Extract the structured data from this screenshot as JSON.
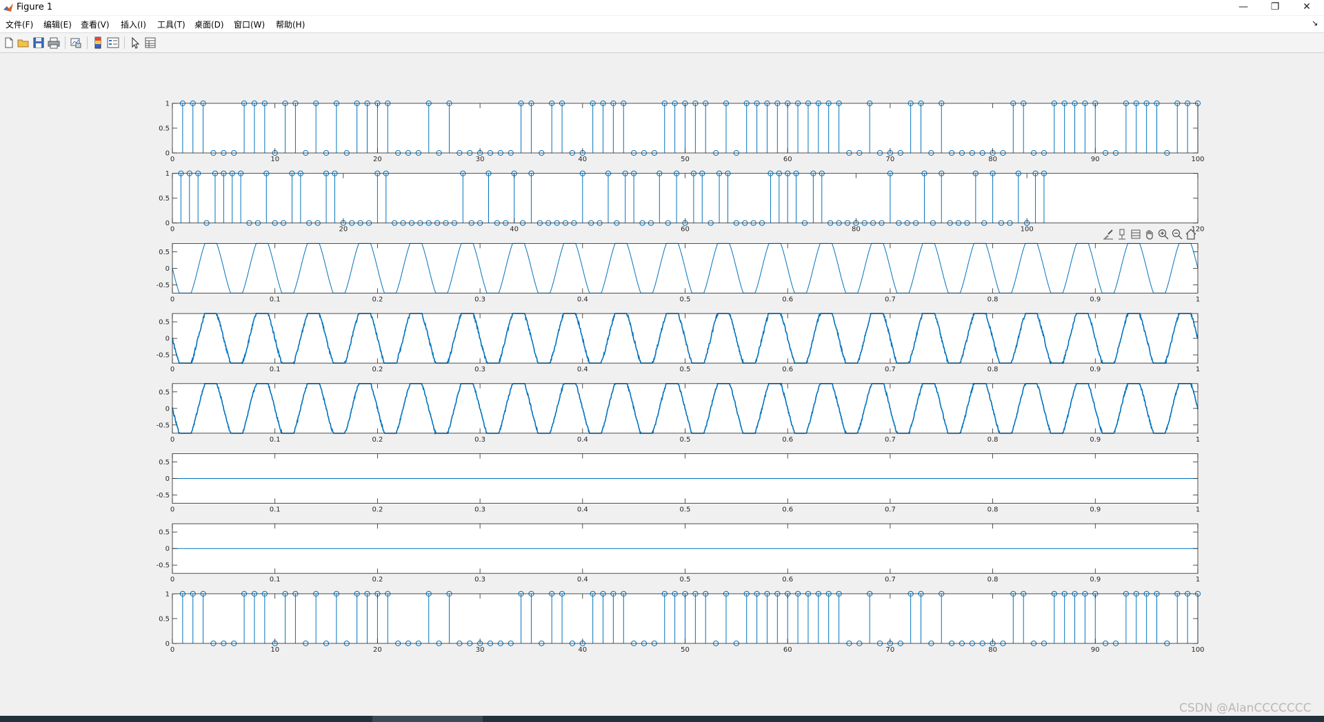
{
  "window": {
    "title": "Figure 1",
    "minimize": "—",
    "maximize": "❐",
    "close": "✕"
  },
  "menu": [
    {
      "label": "文件(F)"
    },
    {
      "label": "编辑(E)"
    },
    {
      "label": "查看(V)"
    },
    {
      "label": "插入(I)"
    },
    {
      "label": "工具(T)"
    },
    {
      "label": "桌面(D)"
    },
    {
      "label": "窗口(W)"
    },
    {
      "label": "帮助(H)"
    }
  ],
  "menu_arrow": "↘",
  "toolbar_icons": [
    "new-figure-icon",
    "open-file-icon",
    "save-icon",
    "print-icon",
    "link-plot-icon",
    "colorbar-icon",
    "legend-icon",
    "edit-plot-icon",
    "property-inspector-icon"
  ],
  "axes_toolbar_icons": [
    "brush-icon",
    "data-tips-icon",
    "pan-icon",
    "zoom-in-icon",
    "zoom-out-icon",
    "restore-view-icon"
  ],
  "colors": {
    "line": "#0072bd",
    "axes_bg": "#ffffff",
    "figure_bg": "#f0f0f0"
  },
  "watermark": "CSDN @AlanCCCCCCC",
  "chart_data": [
    {
      "type": "stem",
      "xlim": [
        0,
        100
      ],
      "ylim": [
        0,
        1
      ],
      "xticks": [
        0,
        10,
        20,
        30,
        40,
        50,
        60,
        70,
        80,
        90,
        100
      ],
      "yticks": [
        0,
        0.5,
        1
      ],
      "xticklabels": [
        "0",
        "10",
        "20",
        "30",
        "40",
        "50",
        "60",
        "70",
        "80",
        "90",
        "100"
      ],
      "yticklabels": [
        "0",
        "0.5",
        "1"
      ],
      "x_start": 1,
      "values": [
        1,
        1,
        1,
        0,
        0,
        0,
        1,
        1,
        1,
        0,
        1,
        1,
        0,
        1,
        0,
        1,
        0,
        1,
        1,
        1,
        1,
        0,
        0,
        0,
        1,
        0,
        1,
        0,
        0,
        0,
        0,
        0,
        0,
        1,
        1,
        0,
        1,
        1,
        0,
        0,
        1,
        1,
        1,
        1,
        0,
        0,
        0,
        1,
        1,
        1,
        1,
        1,
        0,
        1,
        0,
        1,
        1,
        1,
        1,
        1,
        1,
        1,
        1,
        1,
        1,
        0,
        0,
        1,
        0,
        0,
        0,
        1,
        1,
        0,
        1,
        0,
        0,
        0,
        0,
        0,
        0,
        1,
        1,
        0,
        0,
        1,
        1,
        1,
        1,
        1,
        0,
        0,
        1,
        1,
        1,
        1,
        0,
        1,
        1,
        1
      ]
    },
    {
      "type": "stem",
      "xlim": [
        0,
        120
      ],
      "ylim": [
        0,
        1
      ],
      "xticks": [
        0,
        20,
        40,
        60,
        80,
        100,
        120
      ],
      "yticks": [
        0,
        0.5,
        1
      ],
      "xticklabels": [
        "0",
        "20",
        "40",
        "60",
        "80",
        "100",
        "120"
      ],
      "yticklabels": [
        "0",
        "0.5",
        "1"
      ],
      "x_start": 1,
      "values": [
        1,
        1,
        1,
        0,
        1,
        1,
        1,
        1,
        0,
        0,
        1,
        0,
        0,
        1,
        1,
        0,
        0,
        1,
        1,
        0,
        0,
        0,
        0,
        1,
        1,
        0,
        0,
        0,
        0,
        0,
        0,
        0,
        0,
        1,
        0,
        0,
        1,
        0,
        0,
        1,
        0,
        1,
        0,
        0,
        0,
        0,
        0,
        1,
        0,
        0,
        1,
        0,
        1,
        1,
        0,
        0,
        1,
        0,
        1,
        0,
        1,
        1,
        0,
        1,
        1,
        0,
        0,
        0,
        0,
        1,
        1,
        1,
        1,
        0,
        1,
        1,
        0,
        0,
        0,
        0,
        0,
        0,
        0,
        1,
        0,
        0,
        0,
        1,
        0,
        1,
        0,
        0,
        0,
        1,
        0,
        1,
        0,
        0,
        1,
        0,
        1,
        1
      ]
    },
    {
      "type": "line",
      "signal": "sine",
      "xlim": [
        0,
        1
      ],
      "ylim": [
        -0.75,
        0.75
      ],
      "amplitude": 1,
      "frequency": 20,
      "noise": 0,
      "clip": true,
      "xticks": [
        0,
        0.1,
        0.2,
        0.3,
        0.4,
        0.5,
        0.6,
        0.7,
        0.8,
        0.9,
        1
      ],
      "yticks": [
        -0.5,
        0,
        0.5
      ],
      "xticklabels": [
        "0",
        "0.1",
        "0.2",
        "0.3",
        "0.4",
        "0.5",
        "0.6",
        "0.7",
        "0.8",
        "0.9",
        "1"
      ],
      "yticklabels": [
        "-0.5",
        "0",
        "0.5"
      ]
    },
    {
      "type": "line",
      "signal": "sine",
      "xlim": [
        0,
        1
      ],
      "ylim": [
        -0.75,
        0.75
      ],
      "amplitude": 1,
      "frequency": 20,
      "noise": 0.05,
      "clip": true,
      "xticks": [
        0,
        0.1,
        0.2,
        0.3,
        0.4,
        0.5,
        0.6,
        0.7,
        0.8,
        0.9,
        1
      ],
      "yticks": [
        -0.5,
        0,
        0.5
      ],
      "xticklabels": [
        "0",
        "0.1",
        "0.2",
        "0.3",
        "0.4",
        "0.5",
        "0.6",
        "0.7",
        "0.8",
        "0.9",
        "1"
      ],
      "yticklabels": [
        "-0.5",
        "0",
        "0.5"
      ]
    },
    {
      "type": "line",
      "signal": "sine",
      "xlim": [
        0,
        1
      ],
      "ylim": [
        -0.75,
        0.75
      ],
      "amplitude": 1,
      "frequency": 20,
      "noise": 0.04,
      "clip": true,
      "xticks": [
        0,
        0.1,
        0.2,
        0.3,
        0.4,
        0.5,
        0.6,
        0.7,
        0.8,
        0.9,
        1
      ],
      "yticks": [
        -0.5,
        0,
        0.5
      ],
      "xticklabels": [
        "0",
        "0.1",
        "0.2",
        "0.3",
        "0.4",
        "0.5",
        "0.6",
        "0.7",
        "0.8",
        "0.9",
        "1"
      ],
      "yticklabels": [
        "-0.5",
        "0",
        "0.5"
      ]
    },
    {
      "type": "line",
      "signal": "constant",
      "value": 0,
      "xlim": [
        0,
        1
      ],
      "ylim": [
        -0.75,
        0.75
      ],
      "xticks": [
        0,
        0.1,
        0.2,
        0.3,
        0.4,
        0.5,
        0.6,
        0.7,
        0.8,
        0.9,
        1
      ],
      "yticks": [
        -0.5,
        0,
        0.5
      ],
      "xticklabels": [
        "0",
        "0.1",
        "0.2",
        "0.3",
        "0.4",
        "0.5",
        "0.6",
        "0.7",
        "0.8",
        "0.9",
        "1"
      ],
      "yticklabels": [
        "-0.5",
        "0",
        "0.5"
      ]
    },
    {
      "type": "line",
      "signal": "constant",
      "value": 0,
      "xlim": [
        0,
        1
      ],
      "ylim": [
        -0.75,
        0.75
      ],
      "xticks": [
        0,
        0.1,
        0.2,
        0.3,
        0.4,
        0.5,
        0.6,
        0.7,
        0.8,
        0.9,
        1
      ],
      "yticks": [
        -0.5,
        0,
        0.5
      ],
      "xticklabels": [
        "0",
        "0.1",
        "0.2",
        "0.3",
        "0.4",
        "0.5",
        "0.6",
        "0.7",
        "0.8",
        "0.9",
        "1"
      ],
      "yticklabels": [
        "-0.5",
        "0",
        "0.5"
      ]
    },
    {
      "type": "stem",
      "xlim": [
        0,
        100
      ],
      "ylim": [
        0,
        1
      ],
      "xticks": [
        0,
        10,
        20,
        30,
        40,
        50,
        60,
        70,
        80,
        90,
        100
      ],
      "yticks": [
        0,
        0.5,
        1
      ],
      "xticklabels": [
        "0",
        "10",
        "20",
        "30",
        "40",
        "50",
        "60",
        "70",
        "80",
        "90",
        "100"
      ],
      "yticklabels": [
        "0",
        "0.5",
        "1"
      ],
      "x_start": 1,
      "values": [
        1,
        1,
        1,
        0,
        0,
        0,
        1,
        1,
        1,
        0,
        1,
        1,
        0,
        1,
        0,
        1,
        0,
        1,
        1,
        1,
        1,
        0,
        0,
        0,
        1,
        0,
        1,
        0,
        0,
        0,
        0,
        0,
        0,
        1,
        1,
        0,
        1,
        1,
        0,
        0,
        1,
        1,
        1,
        1,
        0,
        0,
        0,
        1,
        1,
        1,
        1,
        1,
        0,
        1,
        0,
        1,
        1,
        1,
        1,
        1,
        1,
        1,
        1,
        1,
        1,
        0,
        0,
        1,
        0,
        0,
        0,
        1,
        1,
        0,
        1,
        0,
        0,
        0,
        0,
        0,
        0,
        1,
        1,
        0,
        0,
        1,
        1,
        1,
        1,
        1,
        0,
        0,
        1,
        1,
        1,
        1,
        0,
        1,
        1,
        1
      ]
    }
  ]
}
